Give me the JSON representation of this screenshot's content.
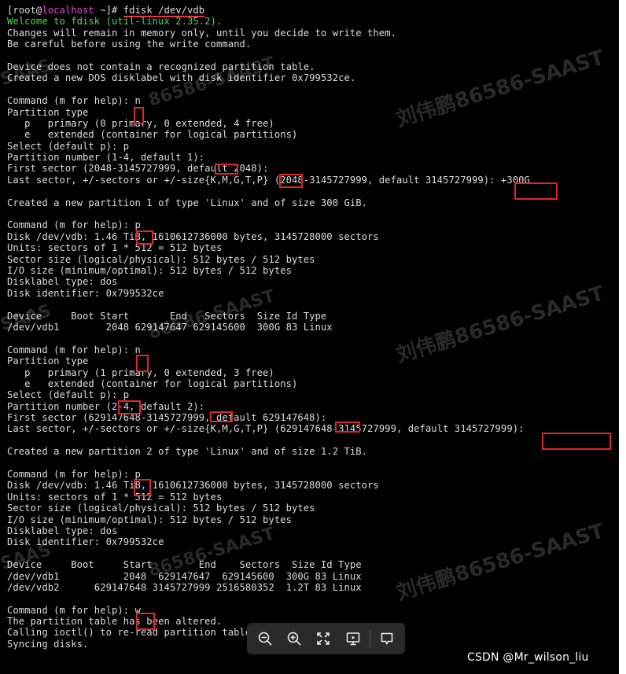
{
  "terminal": {
    "prompt": {
      "prefix": "[root@",
      "host": "localhost",
      "suffix": " ~]# ",
      "command": "fdisk /dev/vdb"
    },
    "lines": [
      "Welcome to fdisk (util-linux 2.35.2).",
      "Changes will remain in memory only, until you decide to write them.",
      "Be careful before using the write command.",
      "",
      "Device does not contain a recognized partition table.",
      "Created a new DOS disklabel with disk identifier 0x799532ce.",
      "",
      "Command (m for help): n",
      "Partition type",
      "   p   primary (0 primary, 0 extended, 4 free)",
      "   e   extended (container for logical partitions)",
      "Select (default p): p",
      "Partition number (1-4, default 1):",
      "First sector (2048-3145727999, default 2048):",
      "Last sector, +/-sectors or +/-size{K,M,G,T,P} (2048-3145727999, default 3145727999): +300G",
      "",
      "Created a new partition 1 of type 'Linux' and of size 300 GiB.",
      "",
      "Command (m for help): p",
      "Disk /dev/vdb: 1.46 TiB, 1610612736000 bytes, 3145728000 sectors",
      "Units: sectors of 1 * 512 = 512 bytes",
      "Sector size (logical/physical): 512 bytes / 512 bytes",
      "I/O size (minimum/optimal): 512 bytes / 512 bytes",
      "Disklabel type: dos",
      "Disk identifier: 0x799532ce",
      "",
      "Device     Boot Start       End   Sectors  Size Id Type",
      "/dev/vdb1        2048 629147647 629145600  300G 83 Linux",
      "",
      "Command (m for help): n",
      "Partition type",
      "   p   primary (1 primary, 0 extended, 3 free)",
      "   e   extended (container for logical partitions)",
      "Select (default p): p",
      "Partition number (2-4, default 2):",
      "First sector (629147648-3145727999, default 629147648):",
      "Last sector, +/-sectors or +/-size{K,M,G,T,P} (629147648-3145727999, default 3145727999):",
      "",
      "Created a new partition 2 of type 'Linux' and of size 1.2 TiB.",
      "",
      "Command (m for help): p",
      "Disk /dev/vdb: 1.46 TiB, 1610612736000 bytes, 3145728000 sectors",
      "Units: sectors of 1 * 512 = 512 bytes",
      "Sector size (logical/physical): 512 bytes / 512 bytes",
      "I/O size (minimum/optimal): 512 bytes / 512 bytes",
      "Disklabel type: dos",
      "Disk identifier: 0x799532ce",
      "",
      "Device     Boot     Start        End    Sectors  Size Id Type",
      "/dev/vdb1           2048  629147647  629145600  300G 83 Linux",
      "/dev/vdb2      629147648 3145727999 2516580352  1.2T 83 Linux",
      "",
      "Command (m for help): w",
      "The partition table has been altered.",
      "Calling ioctl() to re-read partition table.",
      "Syncing disks."
    ]
  },
  "watermarks": [
    "刘伟鹏86586-SAAST",
    "86586-SAAST",
    "SAAS"
  ],
  "toolbar": {
    "buttons": [
      {
        "name": "zoom-out-icon"
      },
      {
        "name": "zoom-in-icon"
      },
      {
        "name": "fullscreen-icon"
      },
      {
        "name": "presentation-icon"
      },
      {
        "name": "comment-icon"
      }
    ]
  },
  "credit": "CSDN @Mr_wilson_liu",
  "colors": {
    "background": "#000000",
    "text": "#dcdcdc",
    "welcome": "#4ddc4d",
    "hostname": "#e04ad0",
    "highlight_box": "#e0242b",
    "toolbar_bg": "#2a2a2c"
  }
}
